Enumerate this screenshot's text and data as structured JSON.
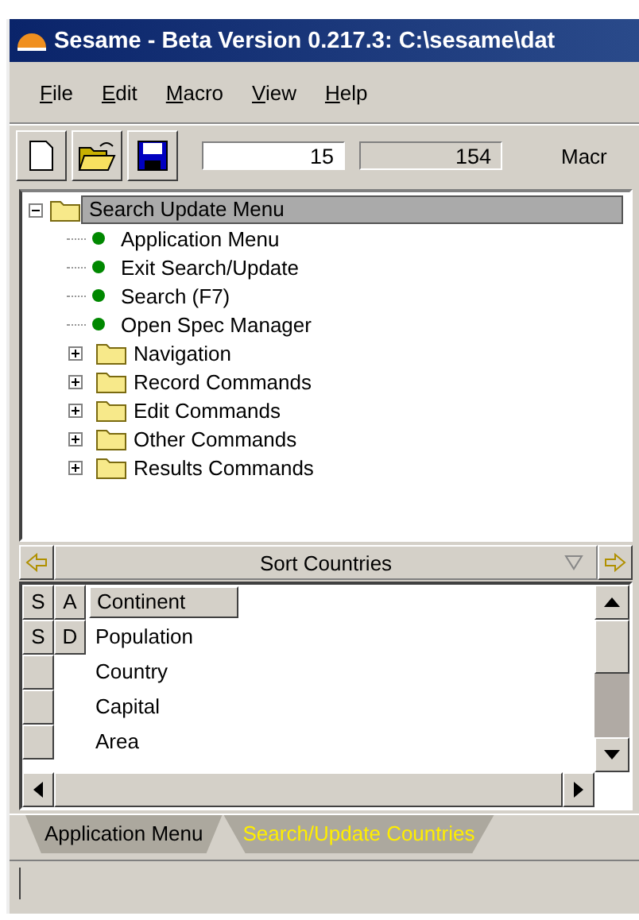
{
  "window": {
    "title": "Sesame - Beta Version 0.217.3: C:\\sesame\\dat"
  },
  "menu": [
    "File",
    "Edit",
    "Macro",
    "View",
    "Help"
  ],
  "toolbar": {
    "buttons": [
      {
        "kind": "new"
      },
      {
        "kind": "open"
      },
      {
        "kind": "save"
      }
    ],
    "record_field": {
      "value": "15"
    },
    "count_field": {
      "value": "154"
    },
    "label": "Macr"
  },
  "tree": {
    "label": "Search Update Menu",
    "expanded": true,
    "selected": true,
    "children": [
      {
        "kind": "command",
        "label": "Application Menu"
      },
      {
        "kind": "command",
        "label": "Exit Search/Update"
      },
      {
        "kind": "command",
        "label": "Search (F7)"
      },
      {
        "kind": "command",
        "label": "Open Spec Manager"
      },
      {
        "kind": "folder",
        "label": "Navigation",
        "expanded": false
      },
      {
        "kind": "folder",
        "label": "Record Commands",
        "expanded": false
      },
      {
        "kind": "folder",
        "label": "Edit Commands",
        "expanded": false
      },
      {
        "kind": "folder",
        "label": "Other Commands",
        "expanded": false
      },
      {
        "kind": "folder",
        "label": "Results Commands",
        "expanded": false
      }
    ]
  },
  "sort_bar": {
    "title": "Sort Countries"
  },
  "sort_fields": [
    {
      "sort": "S",
      "direction": "A",
      "name": "Continent",
      "selected": true
    },
    {
      "sort": "S",
      "direction": "D",
      "name": "Population",
      "selected": false
    },
    {
      "name": "Country",
      "selected": false
    },
    {
      "name": "Capital",
      "selected": false
    },
    {
      "name": "Area",
      "selected": false
    }
  ],
  "tabs": [
    {
      "label": "Application Menu",
      "selected": false
    },
    {
      "label": "Search/Update Countries",
      "selected": true
    }
  ]
}
